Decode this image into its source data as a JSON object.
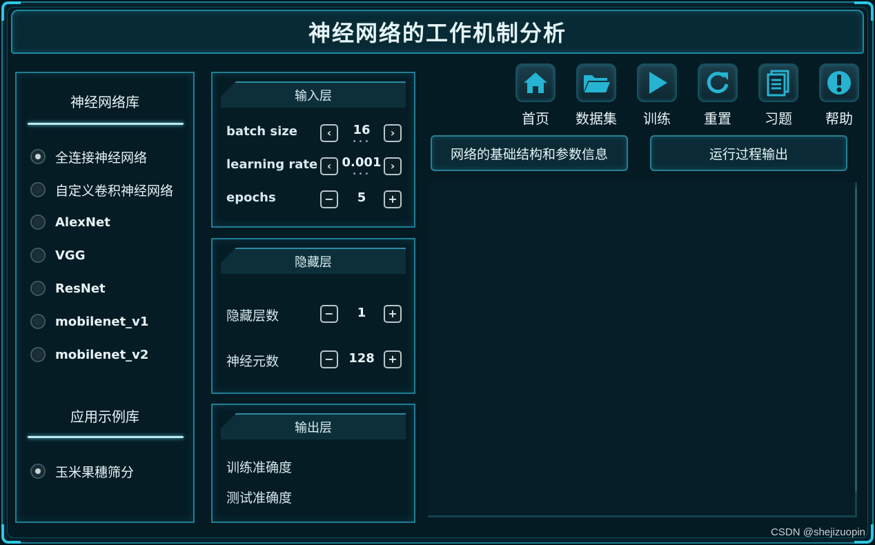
{
  "header": {
    "title": "神经网络的工作机制分析"
  },
  "library": {
    "title": "神经网络库",
    "items": [
      {
        "label": "全连接神经网络",
        "selected": true
      },
      {
        "label": "自定义卷积神经网络",
        "selected": false
      },
      {
        "label": "AlexNet",
        "selected": false
      },
      {
        "label": "VGG",
        "selected": false
      },
      {
        "label": "ResNet",
        "selected": false
      },
      {
        "label": "mobilenet_v1",
        "selected": false
      },
      {
        "label": "mobilenet_v2",
        "selected": false
      }
    ],
    "examples_title": "应用示例库",
    "examples": [
      {
        "label": "玉米果穗筛分",
        "selected": true
      }
    ]
  },
  "input_layer": {
    "title": "输入层",
    "batch_size": {
      "label": "batch size",
      "value": "16",
      "dec": "‹",
      "inc": "›"
    },
    "learning_rate": {
      "label": "learning rate",
      "value": "0.001",
      "dec": "‹",
      "inc": "›"
    },
    "epochs": {
      "label": "epochs",
      "value": "5",
      "dec": "−",
      "inc": "+"
    }
  },
  "hidden_layer": {
    "title": "隐藏层",
    "layers": {
      "label": "隐藏层数",
      "value": "1",
      "dec": "−",
      "inc": "+"
    },
    "neurons": {
      "label": "神经元数",
      "value": "128",
      "dec": "−",
      "inc": "+"
    }
  },
  "output_layer": {
    "title": "输出层",
    "train_acc_label": "训练准确度",
    "test_acc_label": "测试准确度"
  },
  "toolbar": {
    "items": [
      {
        "label": "首页",
        "icon": "home-icon"
      },
      {
        "label": "数据集",
        "icon": "folder-icon"
      },
      {
        "label": "训练",
        "icon": "play-icon"
      },
      {
        "label": "重置",
        "icon": "reset-icon"
      },
      {
        "label": "习题",
        "icon": "document-icon"
      },
      {
        "label": "帮助",
        "icon": "help-icon"
      }
    ]
  },
  "tabs": {
    "structure": "网络的基础结构和参数信息",
    "output": "运行过程输出"
  },
  "watermark": "CSDN @shejizuopin",
  "colors": {
    "accent": "#1aa4c0",
    "panel_border": "#1f7e93",
    "background": "#041b24"
  }
}
